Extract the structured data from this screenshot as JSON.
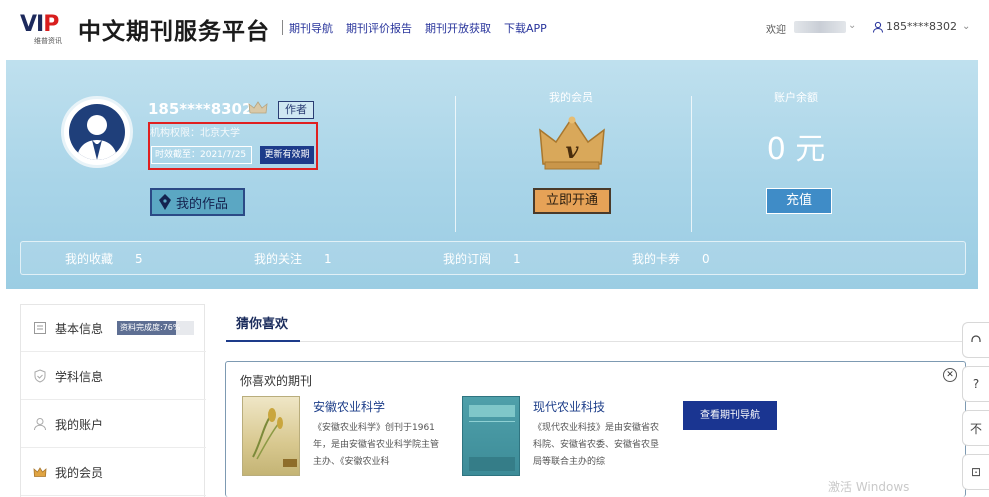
{
  "header": {
    "logo_mark": "VIP",
    "logo_sub": "维普资讯",
    "title": "中文期刊服务平台",
    "nav": [
      "期刊导航",
      "期刊评价报告",
      "期刊开放获取",
      "下载APP"
    ],
    "welcome": "欢迎",
    "user": "185****8302"
  },
  "profile": {
    "username": "185****8302",
    "author_tag": "作者",
    "org": "机构权限：北京大学",
    "valid_until": "时效截至：2021/7/25",
    "renew_label": "更新有效期",
    "works_label": "我的作品"
  },
  "membership": {
    "title": "我的会员",
    "crown_letter": "v",
    "open_label": "立即开通"
  },
  "balance": {
    "title": "账户余额",
    "value": "0 元",
    "recharge_label": "充值"
  },
  "stats": [
    {
      "label": "我的收藏",
      "value": "5"
    },
    {
      "label": "我的关注",
      "value": "1"
    },
    {
      "label": "我的订阅",
      "value": "1"
    },
    {
      "label": "我的卡券",
      "value": "0"
    }
  ],
  "sidebar": {
    "items": [
      {
        "label": "基本信息",
        "icon": "profile-card-icon"
      },
      {
        "label": "学科信息",
        "icon": "shield-icon"
      },
      {
        "label": "我的账户",
        "icon": "user-icon"
      },
      {
        "label": "我的会员",
        "icon": "crown-icon"
      }
    ],
    "completion_label": "资料完成度:76%",
    "completion_fraction": 0.76
  },
  "main": {
    "tab": "猜你喜欢",
    "rec_title": "你喜欢的期刊",
    "journals": [
      {
        "name": "安徽农业科学",
        "desc": "《安徽农业科学》创刊于1961年，是由安徽省农业科学院主管主办、《安徽农业科"
      },
      {
        "name": "现代农业科技",
        "desc": "《现代农业科技》是由安徽省农科院、安徽省农委、安徽省农垦局等联合主办的综"
      }
    ],
    "browse_label": "查看期刊导航"
  },
  "floats": [
    "?",
    "不",
    "⊡"
  ],
  "watermark": "激活 Windows",
  "colors": {
    "brand_dark": "#1d3b8a",
    "link": "#27339b",
    "banner": "#a8d4e8",
    "accent_gold": "#e6a257",
    "alert_red": "#e02020"
  }
}
